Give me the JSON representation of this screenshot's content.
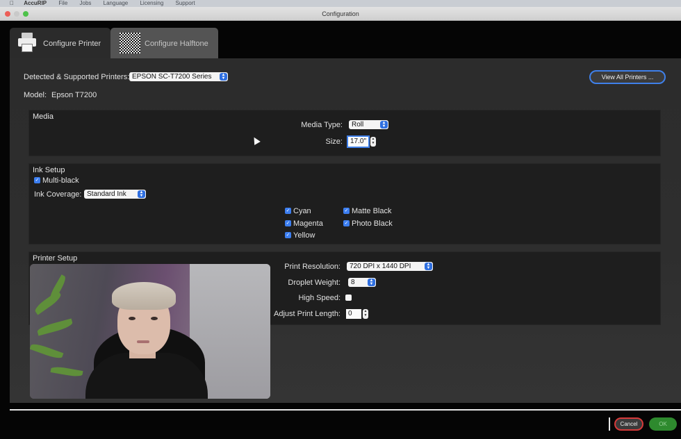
{
  "menubar": {
    "apple": "",
    "items": [
      "AccuRIP",
      "File",
      "Jobs",
      "Language",
      "Licensing",
      "Support"
    ]
  },
  "window": {
    "title": "Configuration"
  },
  "tabs": [
    {
      "label": "Configure Printer",
      "icon": "printer-icon",
      "active": true
    },
    {
      "label": "Configure Halftone",
      "icon": "halftone-checker-icon",
      "active": false
    }
  ],
  "printer": {
    "detected_label": "Detected & Supported Printers:",
    "detected_value": "EPSON SC-T7200 Series",
    "model_label": "Model:",
    "model_value": "Epson T7200",
    "view_all_label": "View All Printers ..."
  },
  "media": {
    "title": "Media",
    "type_label": "Media Type:",
    "type_value": "Roll",
    "size_label": "Size:",
    "size_value": "17.0\""
  },
  "ink": {
    "title": "Ink Setup",
    "multiblack_label": "Multi-black",
    "coverage_label": "Ink Coverage:",
    "coverage_value": "Standard Ink",
    "colors": {
      "cyan": "Cyan",
      "magenta": "Magenta",
      "yellow": "Yellow",
      "matte_black": "Matte Black",
      "photo_black": "Photo Black"
    }
  },
  "printer_setup": {
    "title": "Printer Setup",
    "resolution_label": "Print Resolution:",
    "resolution_value": "720 DPI x 1440 DPI",
    "droplet_label": "Droplet Weight:",
    "droplet_value": "8",
    "high_speed_label": "High Speed:",
    "adjust_label": "Adjust Print Length:",
    "adjust_value": "0"
  },
  "footer": {
    "cancel_label": "Cancel",
    "ok_label": "OK"
  },
  "colors": {
    "accent": "#3f80ea",
    "cancel_border": "#d63a3a",
    "ok": "#2e8a2e",
    "panel": "#1e1e1e"
  }
}
